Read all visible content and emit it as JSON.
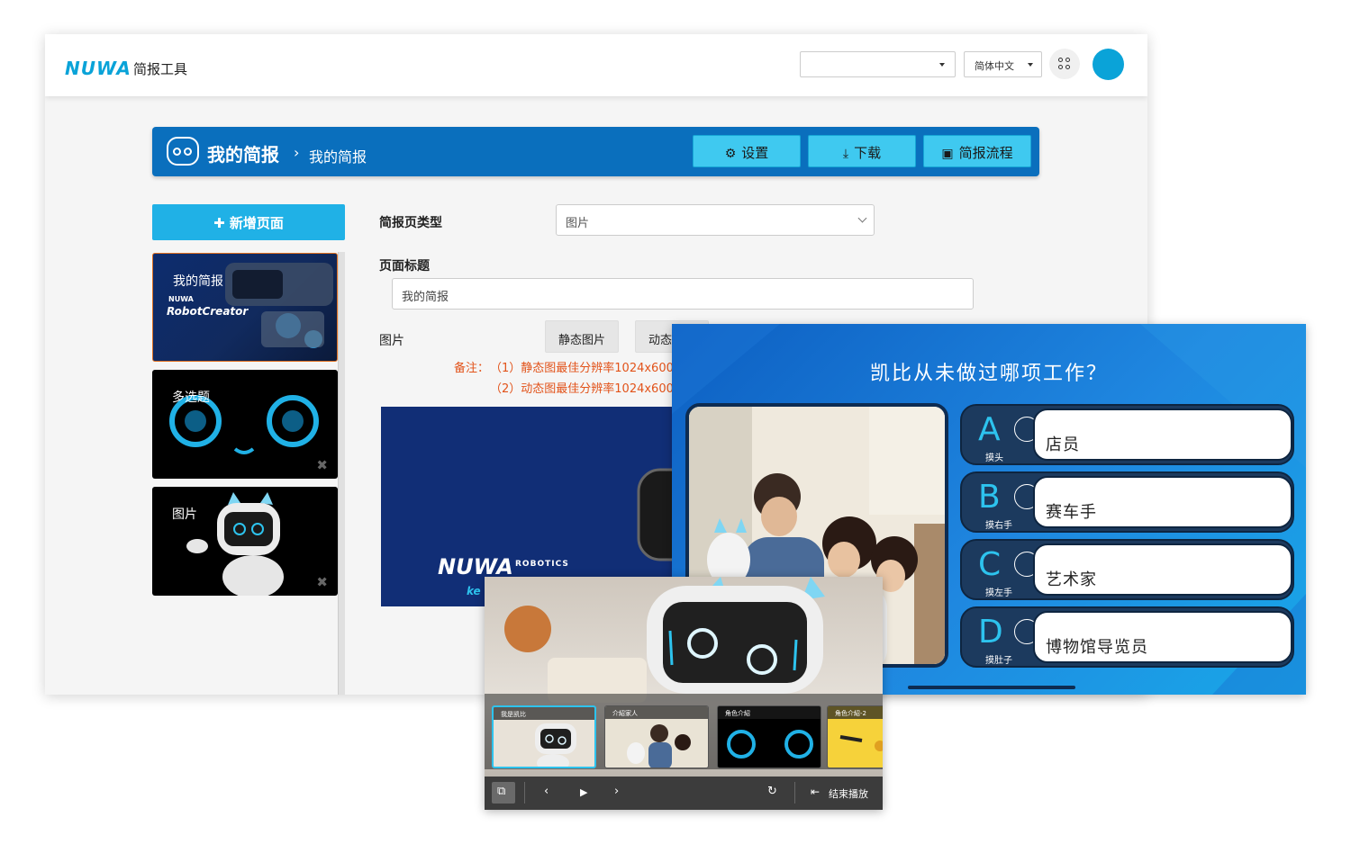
{
  "app": {
    "logo_text": "NUWA",
    "title": "简报工具",
    "language": "简体中文",
    "accent_color": "#0aa3d8"
  },
  "header": {
    "title": "我的简报",
    "separator": "›",
    "breadcrumb": "我的简报",
    "buttons": {
      "settings": "设置",
      "download": "下载",
      "flow": "简报流程"
    }
  },
  "sidebar": {
    "add_button": "新增页面",
    "pages": [
      {
        "label": "我的简报"
      },
      {
        "label": "多选题"
      },
      {
        "label": "图片"
      }
    ],
    "thumb_text": {
      "brand": "NUWA",
      "product": "RobotCreator"
    }
  },
  "form": {
    "type_label": "简报页类型",
    "type_value": "图片",
    "title_label": "页面标题",
    "title_value": "我的简报",
    "image_label": "图片",
    "static_image_btn": "静态图片",
    "dynamic_image_btn": "动态",
    "note_prefix": "备注：",
    "note_1": "（1）静态图最佳分辨率1024x600",
    "note_2": "（2）动态图最佳分辨率1024x600",
    "preview_brand": "NUWA",
    "preview_sub": "ROBOTICS",
    "preview_tail": "ke"
  },
  "quiz": {
    "question": "凯比从未做过哪项工作？",
    "options": [
      {
        "letter": "A",
        "sub": "摸头",
        "text": "店员"
      },
      {
        "letter": "B",
        "sub": "摸右手",
        "text": "赛车手"
      },
      {
        "letter": "C",
        "sub": "摸左手",
        "text": "艺术家"
      },
      {
        "letter": "D",
        "sub": "摸肚子",
        "text": "博物馆导览员"
      }
    ]
  },
  "player": {
    "slides": [
      {
        "caption": "我是凯比"
      },
      {
        "caption": "介紹家人"
      },
      {
        "caption": "角色介紹"
      },
      {
        "caption": "角色介紹-2"
      }
    ],
    "end_label": "结束播放"
  }
}
